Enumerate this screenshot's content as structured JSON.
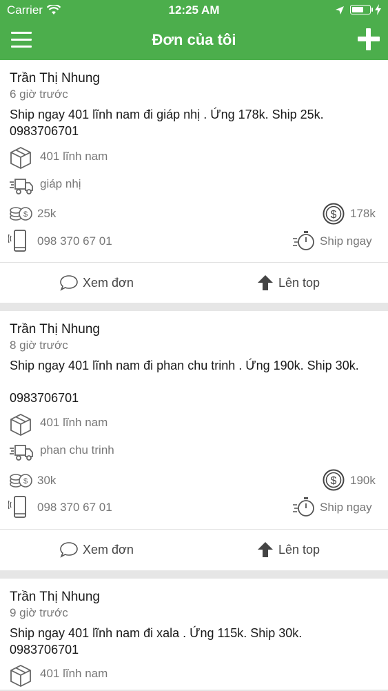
{
  "status_bar": {
    "carrier": "Carrier",
    "time": "12:25 AM"
  },
  "header": {
    "title": "Đơn của tôi"
  },
  "orders": [
    {
      "name": "Trần Thị Nhung",
      "time_ago": "6 giờ trước",
      "description": "Ship ngay 401 lĩnh nam đi giáp nhị  . Ứng 178k. Ship 25k.",
      "description_phone": "0983706701",
      "pickup": "401 lĩnh nam",
      "dropoff": "giáp nhị",
      "ship_fee": "25k",
      "advance": "178k",
      "phone": "098 370 67 01",
      "delivery_type": "Ship ngay",
      "view_label": "Xem đơn",
      "top_label": "Lên top"
    },
    {
      "name": "Trần Thị Nhung",
      "time_ago": "8 giờ trước",
      "description": "Ship ngay 401 lĩnh nam đi phan chu trinh  . Ứng 190k. Ship 30k.",
      "description_phone": "0983706701",
      "pickup": "401 lĩnh nam",
      "dropoff": "phan chu trinh",
      "ship_fee": "30k",
      "advance": "190k",
      "phone": "098 370 67 01",
      "delivery_type": "Ship ngay",
      "view_label": "Xem đơn",
      "top_label": "Lên top"
    },
    {
      "name": "Trần Thị Nhung",
      "time_ago": "9 giờ trước",
      "description": "Ship ngay 401 lĩnh nam đi xala . Ứng 115k. Ship 30k.",
      "description_phone": "0983706701",
      "pickup": "401 lĩnh nam"
    }
  ]
}
